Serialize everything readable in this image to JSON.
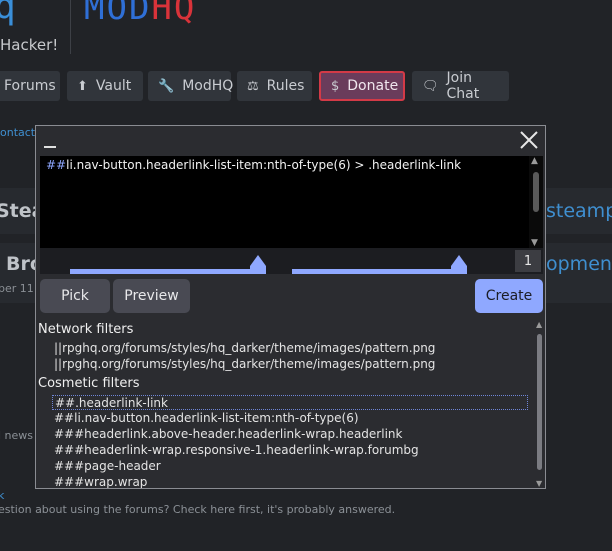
{
  "brand": {
    "logo_glyph": "q",
    "tagline": "Hacker!",
    "title_part1": "MOD",
    "title_part2": "HQ",
    "title_color_1": "#2f6fd6",
    "title_color_2": "#d9333a"
  },
  "navbar": {
    "items": [
      {
        "label": "Forums",
        "icon": "forums-icon",
        "glyph": ""
      },
      {
        "label": "Vault",
        "icon": "upload-icon",
        "glyph": "⬆"
      },
      {
        "label": "ModHQ",
        "icon": "wrench-icon",
        "glyph": "🔧"
      },
      {
        "label": "Rules",
        "icon": "scales-icon",
        "glyph": "⚖"
      },
      {
        "label": "Donate",
        "icon": "dollar-icon",
        "glyph": "$"
      },
      {
        "label": "Join Chat",
        "icon": "chat-icon",
        "glyph": "🗨"
      }
    ],
    "donate_border_color": "#d33a47"
  },
  "background": {
    "contact_link": "ontact",
    "row1_left": "Stea",
    "row1_right": "steampo",
    "row2_left": "Bro",
    "row2_right": "opment.",
    "row2_small": "ber 11",
    "news_fragment": "l news",
    "k_link": "k",
    "faq_text": "estion about using the forums? Check here first, it's probably answered."
  },
  "picker": {
    "minimize_label": "_",
    "close_label": "close",
    "editor": {
      "prefix": "##",
      "selector": "li.nav-button.headerlink-list-item:nth-of-type(6) > .headerlink-link"
    },
    "depth_value": "1",
    "slider_1_level": 0.97,
    "slider_2_level": 0.85,
    "accent_color": "#8fa8ff",
    "buttons": {
      "pick": "Pick",
      "preview": "Preview",
      "create": "Create"
    },
    "network_title": "Network filters",
    "network_rules": [
      "||rpghq.org/forums/styles/hq_darker/theme/images/pattern.png",
      "||rpghq.org/forums/styles/hq_darker/theme/images/pattern.png"
    ],
    "cosmetic_title": "Cosmetic filters",
    "cosmetic_rules": [
      "##.headerlink-link",
      "##li.nav-button.headerlink-list-item:nth-of-type(6)",
      "###headerlink.above-header.headerlink-wrap.headerlink",
      "###headerlink-wrap.responsive-1.headerlink-wrap.forumbg",
      "###page-header",
      "###wrap.wrap"
    ]
  }
}
